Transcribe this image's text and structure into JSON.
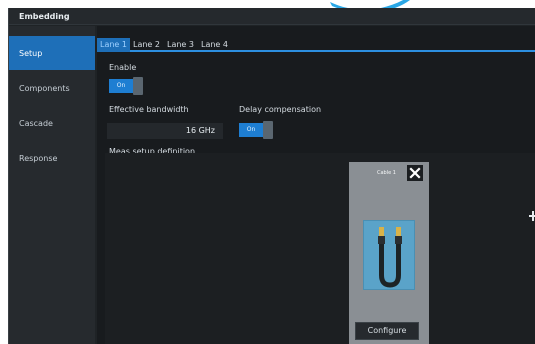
{
  "window": {
    "title": "Embedding"
  },
  "sidebar": {
    "items": [
      {
        "label": "Setup",
        "active": true
      },
      {
        "label": "Components",
        "active": false
      },
      {
        "label": "Cascade",
        "active": false
      },
      {
        "label": "Response",
        "active": false
      }
    ]
  },
  "tabs": [
    {
      "label": "Lane 1",
      "active": true
    },
    {
      "label": "Lane 2",
      "active": false
    },
    {
      "label": "Lane 3",
      "active": false
    },
    {
      "label": "Lane 4",
      "active": false
    }
  ],
  "setup": {
    "enable_label": "Enable",
    "enable_state": "On",
    "bandwidth_label": "Effective bandwidth",
    "bandwidth_value": "16 GHz",
    "delay_label": "Delay compensation",
    "delay_state": "On",
    "meas_setup_label": "Meas setup definition"
  },
  "cable_card": {
    "title": "Cable 1",
    "configure_label": "Configure",
    "icons": {
      "close": "close-icon",
      "cable": "cable-icon"
    }
  },
  "colors": {
    "accent": "#1e6fb8",
    "tab_underline": "#2c8fe0",
    "background": "#181b1e",
    "card": "#8a8f94"
  }
}
